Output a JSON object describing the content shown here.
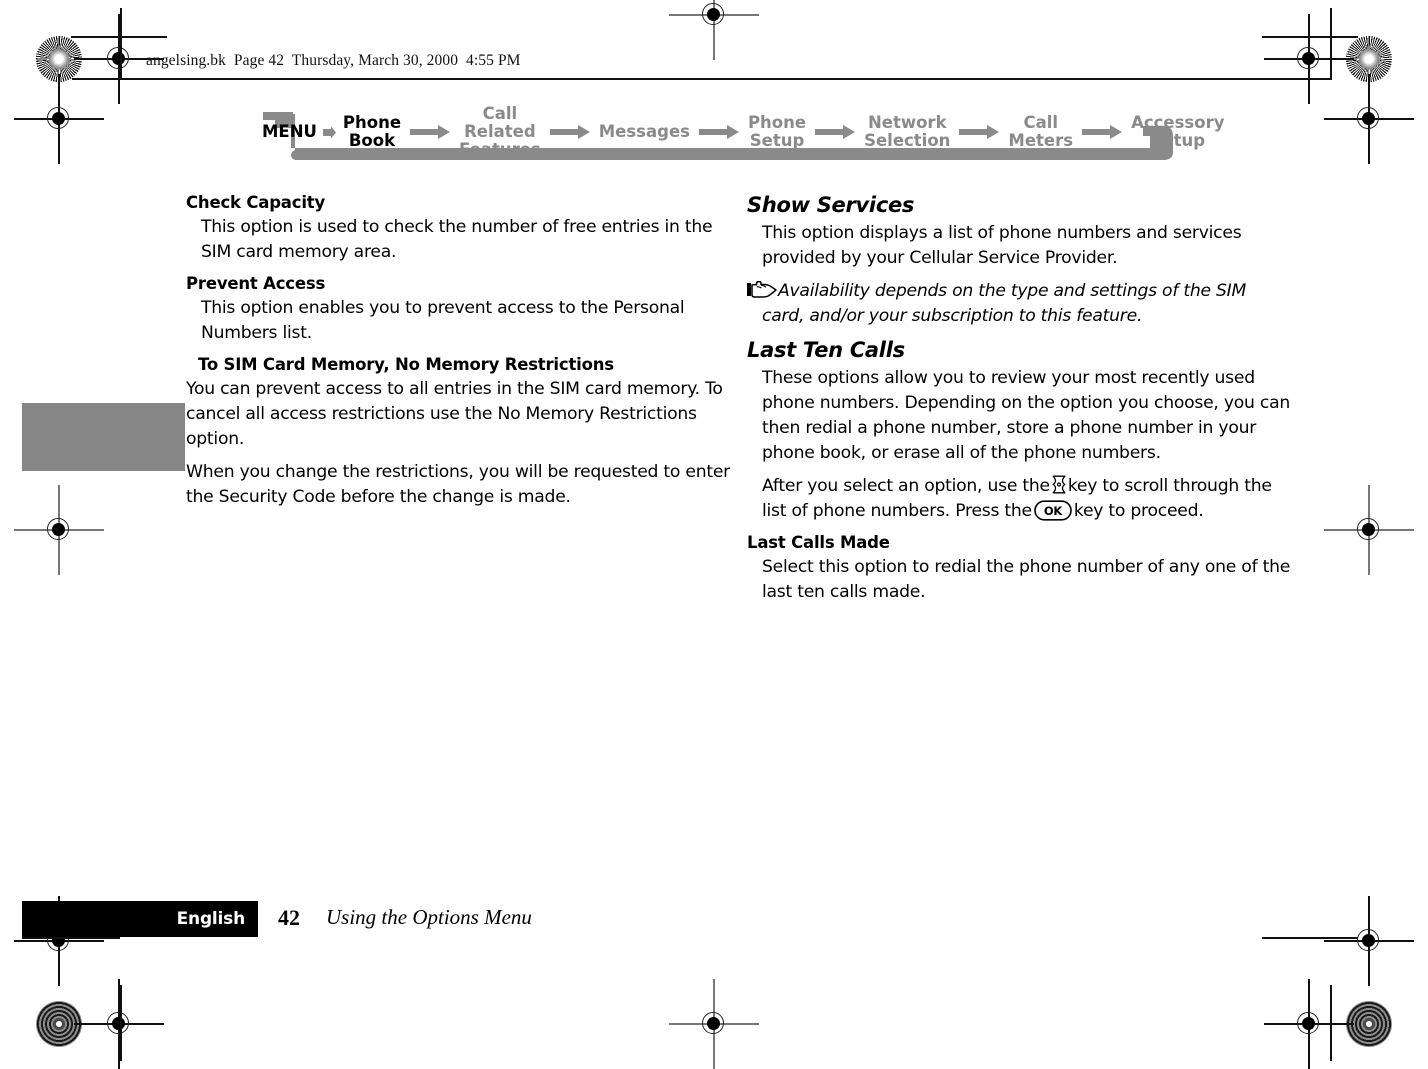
{
  "page": {
    "file_header": "angelsing.bk  Page 42  Thursday, March 30, 2000  4:55 PM"
  },
  "nav": {
    "items": [
      {
        "label": "MENU",
        "active": true
      },
      {
        "label": "Phone\nBook",
        "active": true
      },
      {
        "label": "Call Related\nFeatures",
        "active": false
      },
      {
        "label": "Messages",
        "active": false
      },
      {
        "label": "Phone\nSetup",
        "active": false
      },
      {
        "label": "Network\nSelection",
        "active": false
      },
      {
        "label": "Call\nMeters",
        "active": false
      },
      {
        "label": "Accessory\nSetup",
        "active": false
      }
    ],
    "arrow_icon": "right-arrow-icon",
    "accent_gray": "#8a8a8a"
  },
  "left_column": {
    "sections": [
      {
        "heading": "Check Capacity",
        "paragraphs": [
          "This option is used to check the number of free entries in the SIM card memory area."
        ]
      },
      {
        "heading": "Prevent Access",
        "paragraphs": [
          "This option enables you to prevent access to the Personal Numbers list."
        ]
      },
      {
        "heading": "To SIM Card Memory, No Memory Restrictions",
        "sub": true,
        "paragraphs": [
          "You can prevent access to all entries in the SIM card memory. To cancel all access restrictions use the No Memory Restrictions option.",
          "When you change the restrictions, you will be requested to enter the Security Code before the change is made."
        ]
      }
    ]
  },
  "right_column": {
    "show_services": {
      "heading": "Show Services",
      "paragraph": "This option displays a list of phone numbers and services provided by your Cellular Service Provider.",
      "note_icon": "pointing-hand-icon",
      "note": "Availability depends on the type and settings of the SIM card, and/or your subscription to this feature."
    },
    "last_ten_calls": {
      "heading": "Last Ten Calls",
      "paragraph1": "These options allow you to review your most recently used phone numbers. Depending on the option you choose, you can then redial a phone number, store a phone number in your phone book, or erase all of the phone numbers.",
      "para2_part1": "After you select an option, use the",
      "scroll_key_icon": "scroll-key-icon",
      "para2_part2": "key to scroll through the list of phone numbers. Press the",
      "ok_key_icon": "ok-key-icon",
      "ok_key_label": "OK",
      "para2_part3": "key to proceed."
    },
    "last_calls_made": {
      "heading": "Last Calls Made",
      "paragraph": "Select this option to redial the phone number of any one of the last ten calls made."
    }
  },
  "footer": {
    "language": "English",
    "page_number": "42",
    "section_title": "Using the Options Menu"
  }
}
